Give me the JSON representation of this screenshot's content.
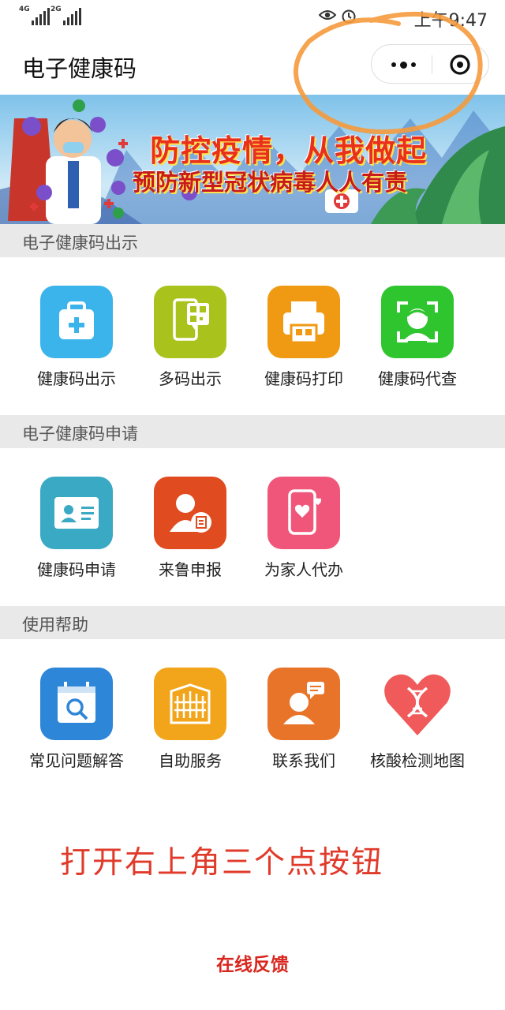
{
  "status_bar": {
    "signal_1_label": "4G",
    "signal_2_label": "2G",
    "time": "上午9:47",
    "icons": [
      "eye-icon",
      "alarm-icon"
    ]
  },
  "title_bar": {
    "title": "电子健康码",
    "more_icon": "more-icon",
    "close_icon": "close-icon"
  },
  "banner": {
    "line1": "防控疫情，从我做起",
    "line2": "预防新型冠状病毒人人有责"
  },
  "sections": [
    {
      "header": "电子健康码出示",
      "items": [
        {
          "label": "健康码出示",
          "icon": "medical-box-icon",
          "color": "#3ab4ea"
        },
        {
          "label": "多码出示",
          "icon": "phone-qr-icon",
          "color": "#a9c21c"
        },
        {
          "label": "健康码打印",
          "icon": "printer-icon",
          "color": "#ef9a12"
        },
        {
          "label": "健康码代查",
          "icon": "face-scan-icon",
          "color": "#2ec52e"
        }
      ]
    },
    {
      "header": "电子健康码申请",
      "items": [
        {
          "label": "健康码申请",
          "icon": "id-card-icon",
          "color": "#3aa9c4"
        },
        {
          "label": "来鲁申报",
          "icon": "person-document-icon",
          "color": "#e04b1f"
        },
        {
          "label": "为家人代办",
          "icon": "phone-heart-icon",
          "color": "#f0567a"
        }
      ]
    },
    {
      "header": "使用帮助",
      "items": [
        {
          "label": "常见问题解答",
          "icon": "calendar-search-icon",
          "color": "#2e86d8"
        },
        {
          "label": "自助服务",
          "icon": "building-icon",
          "color": "#f2a51a"
        },
        {
          "label": "联系我们",
          "icon": "contact-icon",
          "color": "#e8742a"
        },
        {
          "label": "核酸检测地图",
          "icon": "dna-heart-icon",
          "color": "#f05a5a"
        }
      ]
    }
  ],
  "instruction": "打开右上角三个点按钮",
  "feedback": "在线反馈",
  "colors": {
    "annotation_orange": "#f59a3c",
    "instruction_red": "#e03a2a",
    "section_bg": "#e9e9e9"
  }
}
